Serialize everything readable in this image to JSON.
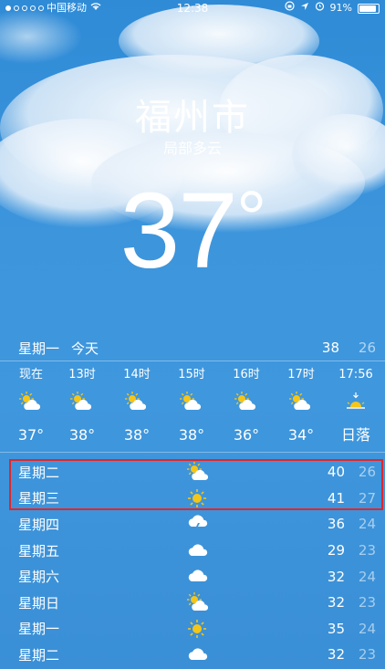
{
  "status_bar": {
    "carrier": "中国移动",
    "time": "12:38",
    "battery": "91%",
    "battery_level": 0.91
  },
  "location": {
    "city": "福州市",
    "condition": "局部多云",
    "temperature": "37",
    "degree_symbol": "°"
  },
  "today": {
    "day": "星期一",
    "label": "今天",
    "high": "38",
    "low": "26"
  },
  "hourly": [
    {
      "label": "现在",
      "icon": "partly-sunny-icon",
      "value": "37°"
    },
    {
      "label": "13时",
      "icon": "partly-sunny-icon",
      "value": "38°"
    },
    {
      "label": "14时",
      "icon": "partly-sunny-icon",
      "value": "38°"
    },
    {
      "label": "15时",
      "icon": "partly-sunny-icon",
      "value": "38°"
    },
    {
      "label": "16时",
      "icon": "partly-sunny-icon",
      "value": "36°"
    },
    {
      "label": "17时",
      "icon": "partly-sunny-icon",
      "value": "34°"
    },
    {
      "label": "17:56",
      "icon": "sunset-icon",
      "value": "日落"
    }
  ],
  "daily": [
    {
      "day": "星期二",
      "icon": "partly-sunny-icon",
      "high": "40",
      "low": "26"
    },
    {
      "day": "星期三",
      "icon": "sun-icon",
      "high": "41",
      "low": "27"
    },
    {
      "day": "星期四",
      "icon": "thunderstorm-icon",
      "high": "36",
      "low": "24"
    },
    {
      "day": "星期五",
      "icon": "cloud-icon",
      "high": "29",
      "low": "23"
    },
    {
      "day": "星期六",
      "icon": "cloud-icon",
      "high": "32",
      "low": "24"
    },
    {
      "day": "星期日",
      "icon": "partly-sunny-icon",
      "high": "32",
      "low": "23"
    },
    {
      "day": "星期一",
      "icon": "sun-icon",
      "high": "35",
      "low": "24"
    },
    {
      "day": "星期二",
      "icon": "cloud-icon",
      "high": "32",
      "low": "23"
    }
  ],
  "colors": {
    "sky": "#3d95dc",
    "highlight_border": "#e0262b",
    "sun": "#f5c518"
  }
}
